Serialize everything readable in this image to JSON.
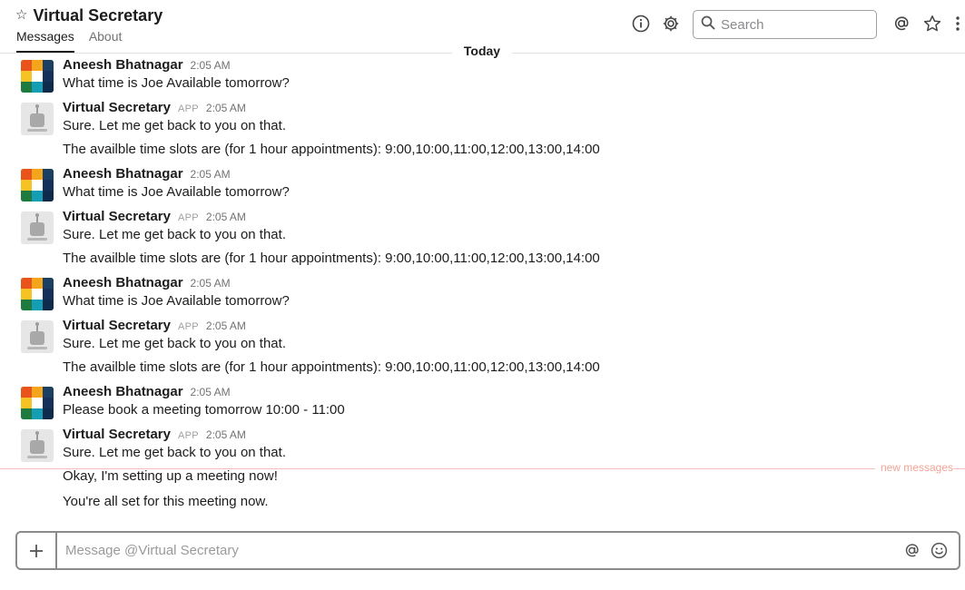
{
  "channel": {
    "title": "Virtual Secretary",
    "star_icon": "star-outline-icon",
    "tabs": [
      {
        "label": "Messages",
        "active": true
      },
      {
        "label": "About",
        "active": false
      }
    ]
  },
  "header_icons": [
    "info-icon",
    "gear-icon",
    "at-icon",
    "star-icon",
    "kebab-menu-icon"
  ],
  "search": {
    "placeholder": "Search",
    "icon": "search-icon"
  },
  "date_divider": "Today",
  "new_messages_label": "new messages",
  "colors": {
    "new_messages": "#f2a396",
    "text": "#1d1c1d",
    "muted": "#717274"
  },
  "messages": [
    {
      "sender": "Aneesh Bhatnagar",
      "app": "",
      "time": "2:05 AM",
      "avatar": "user-avatar",
      "lines": [
        "What time is Joe Available tomorrow?"
      ]
    },
    {
      "sender": "Virtual Secretary",
      "app": "APP",
      "time": "2:05 AM",
      "avatar": "bot-avatar",
      "lines": [
        "Sure. Let me get back to you on that.",
        "The availble time slots are (for 1 hour appointments): 9:00,10:00,11:00,12:00,13:00,14:00"
      ]
    },
    {
      "sender": "Aneesh Bhatnagar",
      "app": "",
      "time": "2:05 AM",
      "avatar": "user-avatar",
      "lines": [
        "What time is Joe Available tomorrow?"
      ]
    },
    {
      "sender": "Virtual Secretary",
      "app": "APP",
      "time": "2:05 AM",
      "avatar": "bot-avatar",
      "lines": [
        "Sure. Let me get back to you on that.",
        "The availble time slots are (for 1 hour appointments): 9:00,10:00,11:00,12:00,13:00,14:00"
      ]
    },
    {
      "sender": "Aneesh Bhatnagar",
      "app": "",
      "time": "2:05 AM",
      "avatar": "user-avatar",
      "lines": [
        "What time is Joe Available tomorrow?"
      ]
    },
    {
      "sender": "Virtual Secretary",
      "app": "APP",
      "time": "2:05 AM",
      "avatar": "bot-avatar",
      "lines": [
        "Sure. Let me get back to you on that.",
        "The availble time slots are (for 1 hour appointments): 9:00,10:00,11:00,12:00,13:00,14:00"
      ]
    },
    {
      "sender": "Aneesh Bhatnagar",
      "app": "",
      "time": "2:05 AM",
      "avatar": "user-avatar",
      "lines": [
        "Please book a meeting tomorrow 10:00 - 11:00"
      ]
    },
    {
      "sender": "Virtual Secretary",
      "app": "APP",
      "time": "2:05 AM",
      "avatar": "bot-avatar",
      "lines": [
        "Sure. Let me get back to you on that.",
        "Okay, I'm setting up a meeting now!",
        "You're all set for this meeting now."
      ]
    }
  ],
  "composer": {
    "placeholder": "Message @Virtual Secretary",
    "plus_icon": "plus-icon",
    "mention_icon": "at-icon",
    "emoji_icon": "emoji-icon"
  }
}
